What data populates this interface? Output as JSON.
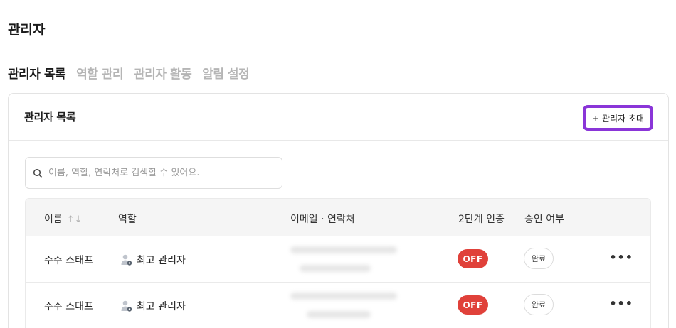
{
  "page": {
    "title": "관리자"
  },
  "tabs": [
    {
      "label": "관리자 목록",
      "active": true
    },
    {
      "label": "역할 관리",
      "active": false
    },
    {
      "label": "관리자 활동",
      "active": false
    },
    {
      "label": "알림 설정",
      "active": false
    }
  ],
  "card": {
    "title": "관리자 목록",
    "invite_button": {
      "icon": "plus-icon",
      "label": "+ 관리자 초대"
    }
  },
  "search": {
    "icon": "search-icon",
    "placeholder": "이름, 역할, 연락처로 검색할 수 있어요.",
    "value": ""
  },
  "table": {
    "headers": {
      "name": "이름",
      "name_sort": "↑↓",
      "role": "역할",
      "contact": "이메일 · 연락처",
      "two_factor": "2단계 인증",
      "approval": "승인 여부"
    },
    "rows": [
      {
        "name": "주주 스태프",
        "role": "최고 관리자",
        "role_icon": "admin-user-icon",
        "contact_blurred": true,
        "two_factor": "OFF",
        "approval": "완료",
        "more": "•••"
      },
      {
        "name": "주주 스태프",
        "role": "최고 관리자",
        "role_icon": "admin-user-icon",
        "contact_blurred": true,
        "two_factor": "OFF",
        "approval": "완료",
        "more": "•••"
      }
    ]
  },
  "colors": {
    "accent_outline": "#8a35d8",
    "off_badge": "#e0413a",
    "inactive_tab": "#b5b5b5"
  }
}
